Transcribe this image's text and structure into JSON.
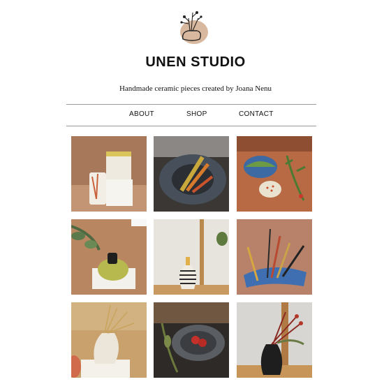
{
  "brand": {
    "name": "UNEN STUDIO",
    "tagline": "Handmade ceramic pieces created by Joana Nenu",
    "logo_icon": "vase-with-flowers-logo"
  },
  "nav": {
    "items": [
      {
        "label": "ABOUT"
      },
      {
        "label": "SHOP"
      },
      {
        "label": "CONTACT"
      }
    ]
  },
  "gallery": {
    "tiles": [
      {
        "subject": "white-cups-with-dried-flowers",
        "bg": "#a8785a"
      },
      {
        "subject": "dark-plate-with-feathers",
        "bg": "#3a3734"
      },
      {
        "subject": "blue-and-white-dishes-on-terracotta",
        "bg": "#b86a44"
      },
      {
        "subject": "green-vase-with-eucalyptus",
        "bg": "#b98662"
      },
      {
        "subject": "striped-bud-vase",
        "bg": "#e7e3dd"
      },
      {
        "subject": "blue-tray-with-brushes",
        "bg": "#b8826a"
      },
      {
        "subject": "white-vase-with-dried-flowers",
        "bg": "#c9a16c"
      },
      {
        "subject": "black-bowl-with-strawberries",
        "bg": "#2e2a27"
      },
      {
        "subject": "black-vase-with-red-berries",
        "bg": "#d8d6d2"
      }
    ]
  }
}
